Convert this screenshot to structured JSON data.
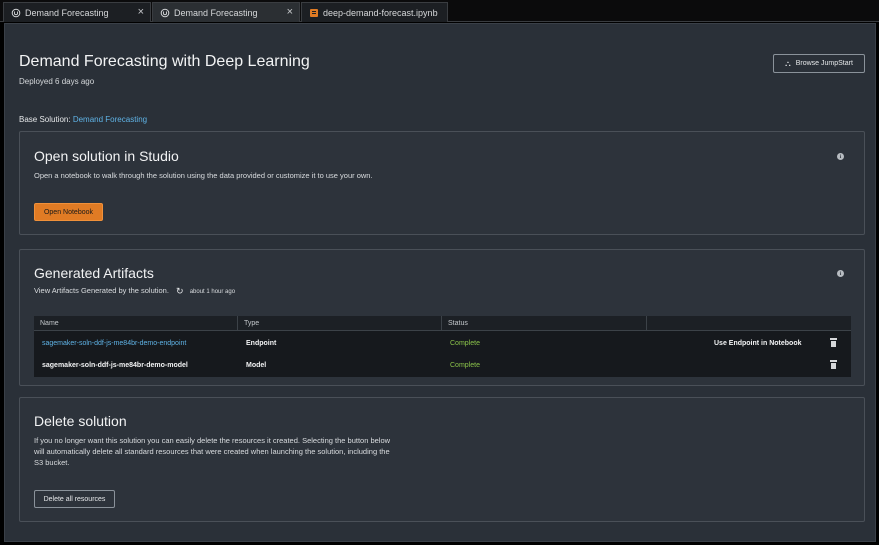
{
  "tabs": [
    {
      "label": "Demand Forecasting",
      "icon": "jumpstart-icon",
      "active": false,
      "close": "×"
    },
    {
      "label": "Demand Forecasting",
      "icon": "jumpstart-icon",
      "active": true,
      "close": "×"
    },
    {
      "label": "deep-demand-forecast.ipynb",
      "icon": "notebook-icon",
      "active": false,
      "close": ""
    }
  ],
  "header": {
    "title": "Demand Forecasting with Deep Learning",
    "deployed": "Deployed 6 days ago",
    "browse_label": "Browse JumpStart",
    "browse_icon": "⛬"
  },
  "base_solution": {
    "label": "Base Solution:",
    "link": "Demand Forecasting"
  },
  "studio": {
    "title": "Open solution in Studio",
    "description": "Open a notebook to walk through the solution using the data provided or customize it to use your own.",
    "button": "Open Notebook",
    "info": "i"
  },
  "artifacts": {
    "title": "Generated Artifacts",
    "description": "View Artifacts Generated by the solution.",
    "refresh_icon": "↻",
    "updated": "about 1 hour ago",
    "info": "i",
    "columns": [
      "Name",
      "Type",
      "Status",
      ""
    ],
    "rows": [
      {
        "name": "sagemaker-soln-ddf-js-me84br-demo-endpoint",
        "type": "Endpoint",
        "status": "Complete",
        "action": "Use Endpoint in Notebook"
      },
      {
        "name": "sagemaker-soln-ddf-js-me84br-demo-model",
        "type": "Model",
        "status": "Complete",
        "action": ""
      }
    ]
  },
  "delete": {
    "title": "Delete solution",
    "line1": "If you no longer want this solution you can easily delete the resources it created. Selecting the button below",
    "line2": "will automatically delete all standard resources that were created when launching the solution, including the",
    "line3": "S3 bucket.",
    "button": "Delete all resources"
  },
  "colors": {
    "accent": "#e07b24",
    "link": "#5fb3e6",
    "success": "#8bc34a",
    "panel": "#2a3038"
  }
}
